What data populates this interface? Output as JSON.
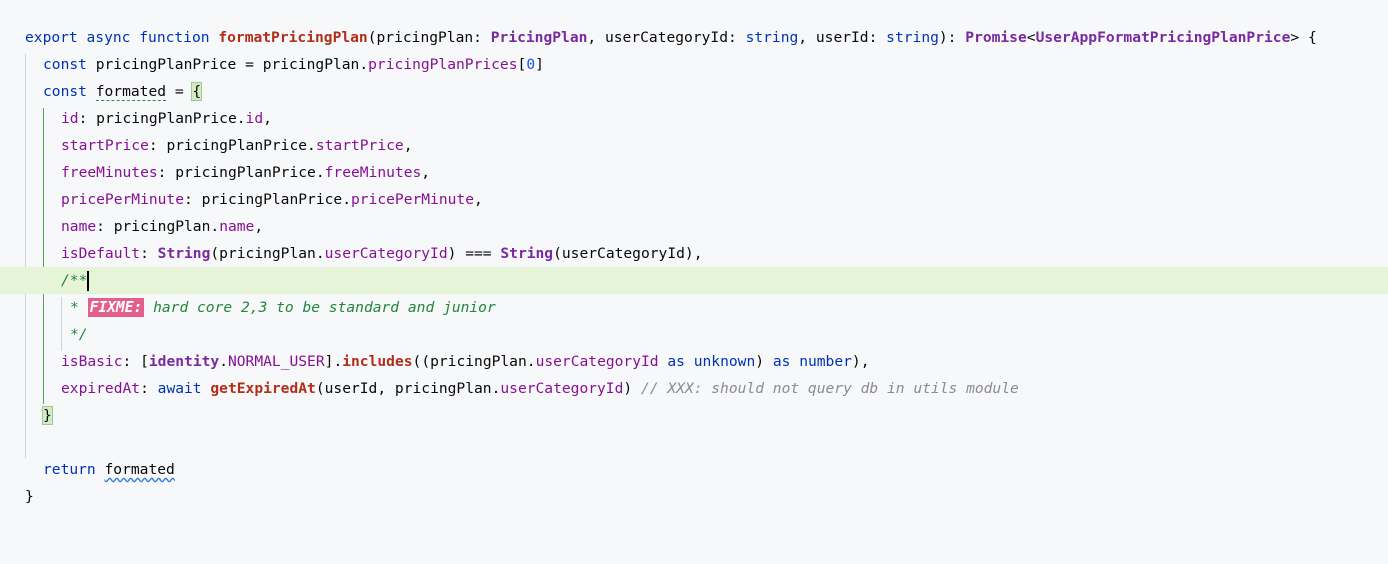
{
  "code": {
    "l1": {
      "kw_export": "export",
      "kw_async": "async",
      "kw_function": "function",
      "fn_name": "formatPricingPlan",
      "p_open": "(",
      "param1": "pricingPlan",
      "colon1": ": ",
      "type1": "PricingPlan",
      "comma1": ", ",
      "param2": "userCategoryId",
      "colon2": ": ",
      "type2": "string",
      "comma2": ", ",
      "param3": "userId",
      "colon3": ": ",
      "type3": "string",
      "p_close": "): ",
      "ret_type": "Promise",
      "lt": "<",
      "ret_inner": "UserAppFormatPricingPlanPrice",
      "gt": "> {"
    },
    "l2": {
      "kw_const": "const",
      "var": "pricingPlanPrice",
      "eq": " = ",
      "obj": "pricingPlan",
      "dot": ".",
      "prop": "pricingPlanPrices",
      "br_open": "[",
      "index": "0",
      "br_close": "]"
    },
    "l3": {
      "kw_const": "const",
      "var": "formated",
      "eq": " = ",
      "brace": "{"
    },
    "l4": {
      "key": "id",
      "colon": ": ",
      "obj": "pricingPlanPrice",
      "dot": ".",
      "prop": "id",
      "comma": ","
    },
    "l5": {
      "key": "startPrice",
      "colon": ": ",
      "obj": "pricingPlanPrice",
      "dot": ".",
      "prop": "startPrice",
      "comma": ","
    },
    "l6": {
      "key": "freeMinutes",
      "colon": ": ",
      "obj": "pricingPlanPrice",
      "dot": ".",
      "prop": "freeMinutes",
      "comma": ","
    },
    "l7": {
      "key": "pricePerMinute",
      "colon": ": ",
      "obj": "pricingPlanPrice",
      "dot": ".",
      "prop": "pricePerMinute",
      "comma": ","
    },
    "l8": {
      "key": "name",
      "colon": ": ",
      "obj": "pricingPlan",
      "dot": ".",
      "prop": "name",
      "comma": ","
    },
    "l9": {
      "key": "isDefault",
      "colon": ": ",
      "string1": "String",
      "p1": "(",
      "obj": "pricingPlan",
      "dot": ".",
      "prop": "userCategoryId",
      "p2": ")",
      "op": " === ",
      "string2": "String",
      "p3": "(",
      "arg": "userCategoryId",
      "p4": "),"
    },
    "l10": {
      "doc_open": "/**"
    },
    "l11": {
      "star": "* ",
      "tag": "FIXME:",
      "text": " hard core 2,3 to be standard and junior"
    },
    "l12": {
      "doc_close": "*/"
    },
    "l13": {
      "key": "isBasic",
      "colon": ": ",
      "br_open": "[",
      "identity": "identity",
      "dot": ".",
      "const": "NORMAL_USER",
      "br_close": "]",
      "dot2": ".",
      "method": "includes",
      "p_open": "((",
      "obj": "pricingPlan",
      "dot3": ".",
      "prop": "userCategoryId",
      "kw_as1": " as ",
      "type_unknown": "unknown",
      "p_mid": ") ",
      "kw_as2": "as ",
      "type_number": "number",
      "p_close": "),"
    },
    "l14": {
      "key": "expiredAt",
      "colon": ": ",
      "kw_await": "await",
      "fn": "getExpiredAt",
      "p_open": "(",
      "arg1": "userId",
      "comma": ", ",
      "obj": "pricingPlan",
      "dot": ".",
      "prop": "userCategoryId",
      "p_close": ")",
      "comment": "// XXX: should not query db in utils module"
    },
    "l15": {
      "brace": "}"
    },
    "l17": {
      "kw_return": "return",
      "var": "formated"
    },
    "l18": {
      "brace": "}"
    }
  }
}
